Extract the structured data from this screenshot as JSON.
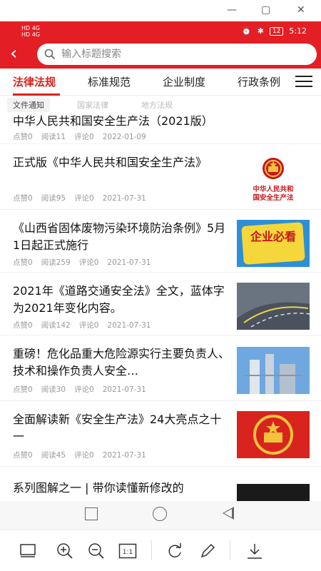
{
  "status_bar": {
    "left_lines": [
      "HD 4G",
      "HD 4G"
    ],
    "battery": "12",
    "time": "5:12"
  },
  "search": {
    "placeholder": "输入标题搜索"
  },
  "tabs": [
    "法律法规",
    "标准规范",
    "企业制度",
    "行政条例"
  ],
  "subtabs": [
    "文件通知",
    "国家法律",
    "地方法规"
  ],
  "articles": [
    {
      "title": "中华人民共和国安全生产法（2021版）",
      "likes": "点赞0",
      "reads": "阅读11",
      "comments": "评论0",
      "date": "2022-01-09"
    },
    {
      "title": "正式版《中华人民共和国安全生产法》",
      "likes": "点赞0",
      "reads": "阅读95",
      "comments": "评论0",
      "date": "2021-07-31",
      "thumb_text": "中华人民共和国安全生产法"
    },
    {
      "title": "《山西省固体废物污染环境防治条例》5月1日起正式施行",
      "likes": "点赞0",
      "reads": "阅读259",
      "comments": "评论0",
      "date": "2021-07-31",
      "thumb_text": "企业必看"
    },
    {
      "title": "2021年《道路交通安全法》全文，蓝体字为2021年变化内容。",
      "likes": "点赞0",
      "reads": "阅读142",
      "comments": "评论0",
      "date": "2021-07-31"
    },
    {
      "title": "重磅！危化品重大危险源实行主要负责人、技术和操作负责人安全…",
      "likes": "点赞0",
      "reads": "阅读30",
      "comments": "评论0",
      "date": "2021-07-31"
    },
    {
      "title": "全面解读新《安全生产法》24大亮点之十一",
      "likes": "点赞0",
      "reads": "阅读45",
      "comments": "评论0",
      "date": "2021-07-31"
    },
    {
      "title": "系列图解之一 | 带你读懂新修改的"
    }
  ],
  "colors": {
    "brand_red": "#e31e24"
  }
}
